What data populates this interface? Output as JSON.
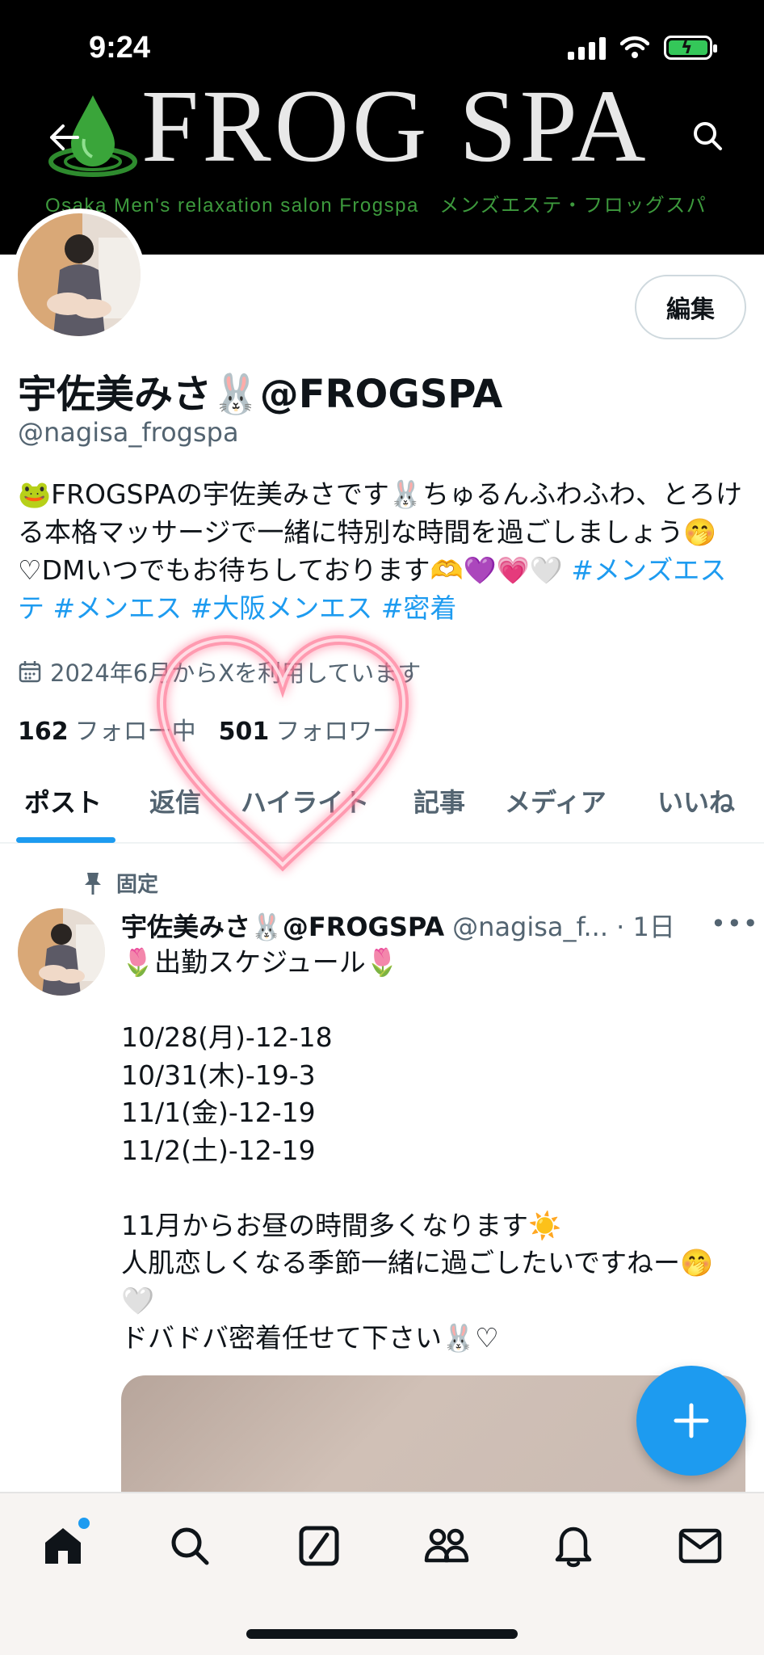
{
  "status": {
    "time": "9:24"
  },
  "banner": {
    "wordmark": "FROG SPA",
    "tagline": "Osaka Men's relaxation salon Frogspa　メンズエステ・フロッグスパ"
  },
  "profile": {
    "edit_label": "編集",
    "display_name": "宇佐美みさ🐰@FROGSPA",
    "handle": "@nagisa_frogspa",
    "bio_text": "🐸FROGSPAの宇佐美みさです🐰ちゅるんふわふわ、とろける本格マッサージで一緒に特別な時間を過ごしましょう🤭♡DMいつでもお待ちしております🫶💜💗🤍 ",
    "bio_tags": "#メンズエステ #メンエス #大阪メンエス #密着",
    "joined": "2024年6月からXを利用しています",
    "following_count": "162",
    "following_label": "フォロー中",
    "followers_count": "501",
    "followers_label": "フォロワー"
  },
  "tabs": [
    {
      "label": "ポスト"
    },
    {
      "label": "返信"
    },
    {
      "label": "ハイライト"
    },
    {
      "label": "記事"
    },
    {
      "label": "メディア"
    },
    {
      "label": "いいね"
    }
  ],
  "post": {
    "pinned_label": "固定",
    "author_name": "宇佐美みさ🐰@FROGSPA",
    "author_meta": "@nagisa_f... · 1日",
    "more": "•••",
    "body": "🌷出勤スケジュール🌷\n\n10/28(月)-12-18\n10/31(木)-19-3\n11/1(金)-12-19\n11/2(土)-12-19\n\n11月からお昼の時間多くなります☀️\n人肌恋しくなる季節一緒に過ごしたいですねー🤭🤍\nドバドバ密着任せて下さい🐰♡"
  },
  "colors": {
    "accent": "#1d9bf0",
    "text": "#0f1419",
    "secondary": "#536471",
    "brand_green": "#3d9a3d",
    "heart": "#ff4f7a"
  },
  "icons": {
    "back": "arrow-left-icon",
    "search": "search-icon",
    "calendar": "calendar-icon",
    "pin": "pin-icon",
    "fab": "plus-icon",
    "nav": [
      "home-icon",
      "search-icon",
      "grok-icon",
      "communities-icon",
      "bell-icon",
      "mail-icon"
    ]
  }
}
